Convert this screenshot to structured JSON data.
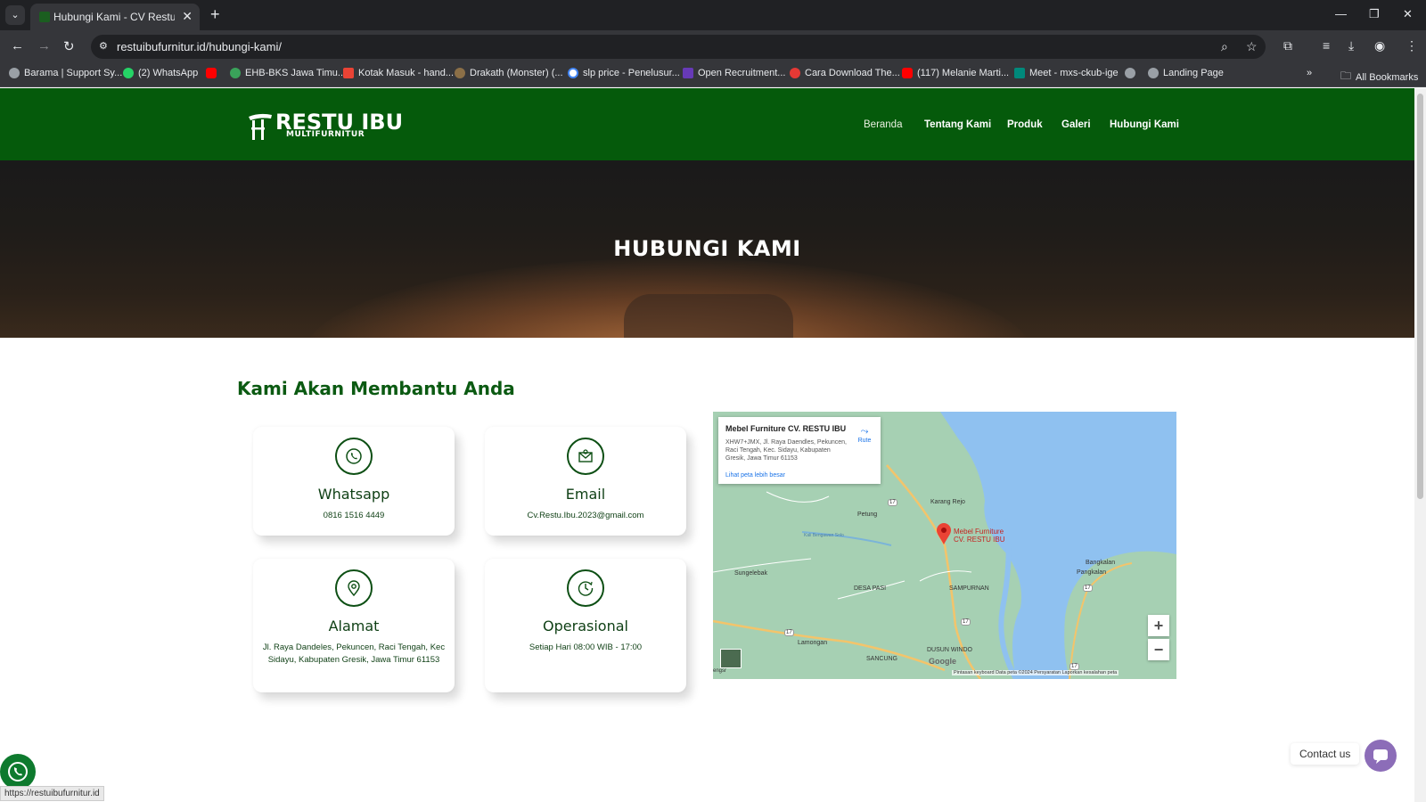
{
  "browser": {
    "tab_title": "Hubungi Kami - CV Restu Ibu F",
    "url": "restuibufurnitur.id/hubungi-kami/",
    "bookmarks": [
      "Barama | Support Sy...",
      "(2) WhatsApp",
      "",
      "EHB-BKS Jawa Timu...",
      "Kotak Masuk - hand...",
      "Drakath (Monster) (...",
      "slp price - Penelusur...",
      "Open Recruitment...",
      "Cara Download The...",
      "(117) Melanie Marti...",
      "Meet - mxs-ckub-ige",
      "",
      "Landing Page"
    ],
    "all_bookmarks": "All Bookmarks",
    "status_url": "https://restuibufurnitur.id"
  },
  "site": {
    "logo_main": "RESTU IBU",
    "logo_sub": "MULTIFURNITUR",
    "nav": [
      "Beranda",
      "Tentang Kami",
      "Produk",
      "Galeri",
      "Hubungi Kami"
    ]
  },
  "hero": {
    "title": "HUBUNGI KAMI"
  },
  "contact": {
    "heading": "Kami Akan Membantu Anda",
    "cards": [
      {
        "icon": "whatsapp-icon",
        "title": "Whatsapp",
        "text": "0816 1516 4449"
      },
      {
        "icon": "email-icon",
        "title": "Email",
        "text": "Cv.Restu.Ibu.2023@gmail.com"
      },
      {
        "icon": "location-icon",
        "title": "Alamat",
        "text": "Jl. Raya Dandeles, Pekuncen, Raci Tengah, Kec Sidayu, Kabupaten Gresik, Jawa Timur 61153"
      },
      {
        "icon": "clock-icon",
        "title": "Operasional",
        "text": "Setiap Hari 08:00 WIB - 17:00"
      }
    ]
  },
  "map": {
    "place_name": "Mebel Furniture CV. RESTU IBU",
    "address": "XHW7+JMX, Jl. Raya Daendles, Pekuncen, Raci Tengah, Kec. Sidayu, Kabupaten Gresik, Jawa Timur 61153",
    "route_label": "Rute",
    "larger_map_link": "Lihat peta lebih besar",
    "pin_label_line1": "Mebel Furniture",
    "pin_label_line2": "CV. RESTU IBU",
    "places": [
      "Karang Rejo",
      "Petung",
      "Sungelebak",
      "DESA PASI",
      "SAMPURNAN",
      "Bangkalan",
      "Pangkalan",
      "Lamongan",
      "DUSUN WINDO",
      "SANCUNG",
      "Kali Bengawan Solo",
      "engsr"
    ],
    "road_numbers": [
      "17",
      "17",
      "17",
      "17",
      "17"
    ],
    "footer": "Pintasan keyboard   Data peta ©2024   Persyaratan   Laporkan kesalahan peta",
    "google": "Google",
    "zoom_in": "+",
    "zoom_out": "−"
  },
  "floating": {
    "contact_us": "Contact us"
  },
  "colors": {
    "brand_green": "#055a0b",
    "text_green": "#0b5a12",
    "contact_purple": "#8c6db8"
  }
}
